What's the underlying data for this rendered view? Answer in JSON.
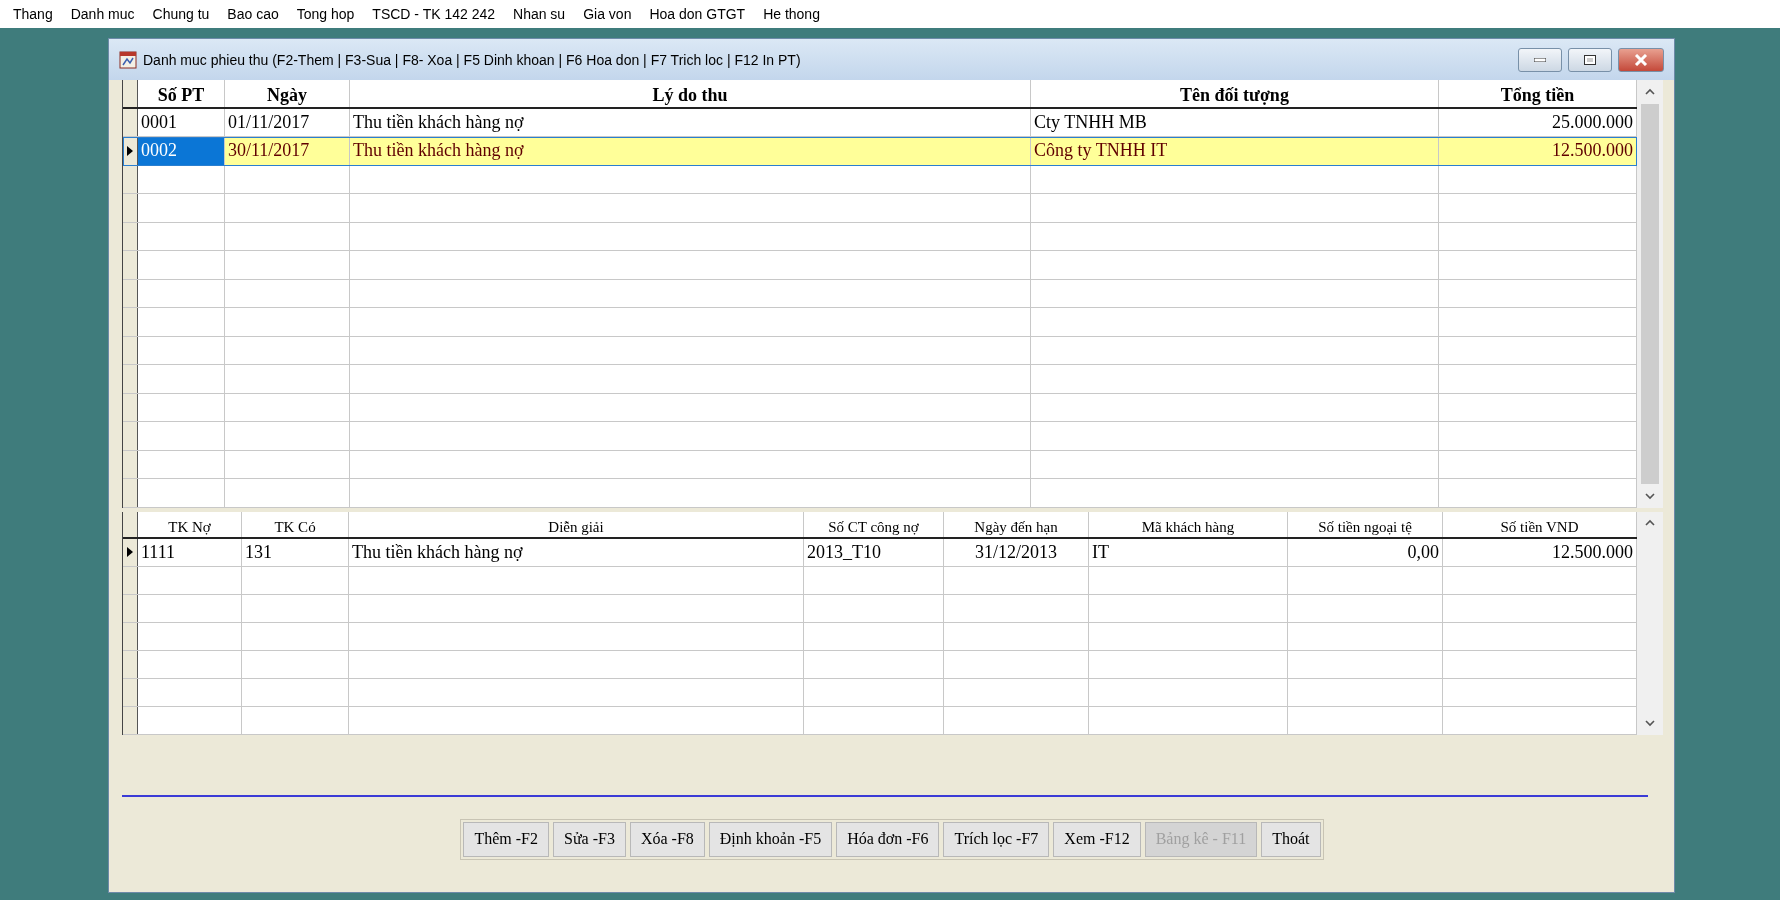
{
  "menu": [
    "Thang",
    "Danh muc",
    "Chung tu",
    "Bao cao",
    "Tong hop",
    "TSCD - TK 142  242",
    "Nhan su",
    "Gia von",
    "Hoa don GTGT",
    "He thong"
  ],
  "window": {
    "title": "Danh muc phieu thu (F2-Them | F3-Sua  | F8- Xoa | F5 Dinh khoan | F6 Hoa don | F7 Trich loc | F12 In PT)"
  },
  "receipts_table": {
    "columns": [
      "Số PT",
      "Ngày",
      "Lý do thu",
      "Tên đối tượng",
      "Tổng tiền"
    ],
    "rows": [
      {
        "cells": [
          "0001",
          "01/11/2017",
          "Thu tiền khách hàng nợ",
          "Cty TNHH MB",
          "25.000.000"
        ],
        "selected": false
      },
      {
        "cells": [
          "0002",
          "30/11/2017",
          "Thu tiền khách hàng nợ",
          "Công ty TNHH IT",
          "12.500.000"
        ],
        "selected": true
      }
    ]
  },
  "entries_table": {
    "columns": [
      "TK Nợ",
      "TK Có",
      "Diễn giải",
      "Số CT công nợ",
      "Ngày đến hạn",
      "Mã khách hàng",
      "Số tiền ngoại tệ",
      "Số tiền VND"
    ],
    "rows": [
      {
        "cells": [
          "1111",
          "131",
          "Thu tiền khách hàng nợ",
          "2013_T10",
          "31/12/2013",
          "IT",
          "0,00",
          "12.500.000"
        ],
        "current": true
      }
    ]
  },
  "buttons": [
    {
      "label": "Thêm -F2",
      "disabled": false
    },
    {
      "label": "Sửa -F3",
      "disabled": false
    },
    {
      "label": "Xóa -F8",
      "disabled": false
    },
    {
      "label": "Định khoản -F5",
      "disabled": false
    },
    {
      "label": "Hóa đơn -F6",
      "disabled": false
    },
    {
      "label": "Trích lọc -F7",
      "disabled": false
    },
    {
      "label": "Xem -F12",
      "disabled": false
    },
    {
      "label": "Bảng kê - F11",
      "disabled": true
    },
    {
      "label": "Thoát",
      "disabled": false
    }
  ]
}
